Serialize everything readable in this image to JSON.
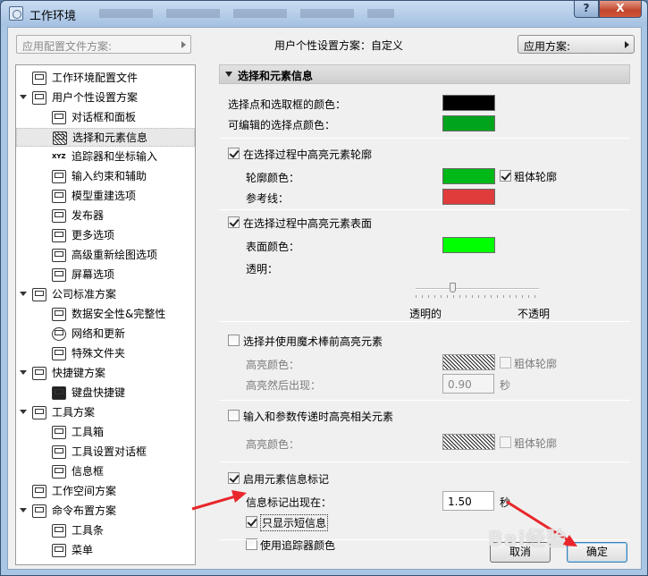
{
  "window": {
    "title": "工作环境",
    "help_glyph": "?",
    "close_glyph": "X"
  },
  "top": {
    "profile_placeholder": "应用配置文件方案:",
    "user_scheme": "用户个性设置方案：自定义",
    "apply_label": "应用方案:"
  },
  "tree": {
    "items": [
      {
        "label": "工作环境配置文件",
        "level": 0,
        "expand": false
      },
      {
        "label": "用户个性设置方案",
        "level": 0,
        "expand": true
      },
      {
        "label": "对话框和面板",
        "level": 1
      },
      {
        "label": "选择和元素信息",
        "level": 1,
        "selected": true
      },
      {
        "label": "追踪器和坐标输入",
        "level": 1
      },
      {
        "label": "输入约束和辅助",
        "level": 1
      },
      {
        "label": "模型重建选项",
        "level": 1
      },
      {
        "label": "发布器",
        "level": 1
      },
      {
        "label": "更多选项",
        "level": 1
      },
      {
        "label": "高级重新绘图选项",
        "level": 1
      },
      {
        "label": "屏幕选项",
        "level": 1
      },
      {
        "label": "公司标准方案",
        "level": 0,
        "expand": true
      },
      {
        "label": "数据安全性&完整性",
        "level": 1
      },
      {
        "label": "网络和更新",
        "level": 1
      },
      {
        "label": "特殊文件夹",
        "level": 1
      },
      {
        "label": "快捷键方案",
        "level": 0,
        "expand": true
      },
      {
        "label": "键盘快捷键",
        "level": 1
      },
      {
        "label": "工具方案",
        "level": 0,
        "expand": true
      },
      {
        "label": "工具箱",
        "level": 1
      },
      {
        "label": "工具设置对话框",
        "level": 1
      },
      {
        "label": "信息框",
        "level": 1
      },
      {
        "label": "工作空间方案",
        "level": 0,
        "expand": false
      },
      {
        "label": "命令布置方案",
        "level": 0,
        "expand": true
      },
      {
        "label": "工具条",
        "level": 1
      },
      {
        "label": "菜单",
        "level": 1
      }
    ]
  },
  "panel": {
    "header": "选择和元素信息",
    "sel_color_label": "选择点和选取框的颜色：",
    "edit_color_label": "可编辑的选择点颜色：",
    "hl_outline_label": "在选择过程中高亮元素轮廓",
    "outline_color_label": "轮廓颜色：",
    "thick_outline_label": "粗体轮廓",
    "ref_line_label": "参考线：",
    "hl_surface_label": "在选择过程中高亮元素表面",
    "surface_color_label": "表面颜色：",
    "transparency_label": "透明：",
    "transparent_label": "透明的",
    "opaque_label": "不透明",
    "magic_wand_label": "选择并使用魔术棒前高亮元素",
    "hl_color_label": "高亮颜色：",
    "thick_outline2_label": "粗体轮廓",
    "hl_after_label": "高亮然后出现：",
    "hl_after_value": "0.90",
    "seconds": "秒",
    "param_pass_label": "输入和参数传递时高亮相关元素",
    "hl_color2_label": "高亮颜色：",
    "thick_outline3_label": "粗体轮廓",
    "info_tag_label": "启用元素信息标记",
    "info_appear_label": "信息标记出现在：",
    "info_appear_value": "1.50",
    "seconds2": "秒",
    "short_info_label": "只显示短信息",
    "tracker_color_label": "使用追踪器颜色"
  },
  "colors": {
    "selection": "#000000",
    "editable": "#00a51c",
    "outline": "#00b818",
    "reference": "#e03c3c",
    "surface": "#00ff00"
  },
  "state": {
    "transparency": 0.3
  },
  "buttons": {
    "cancel": "取消",
    "ok": "确定"
  },
  "watermark": "Bai经验"
}
